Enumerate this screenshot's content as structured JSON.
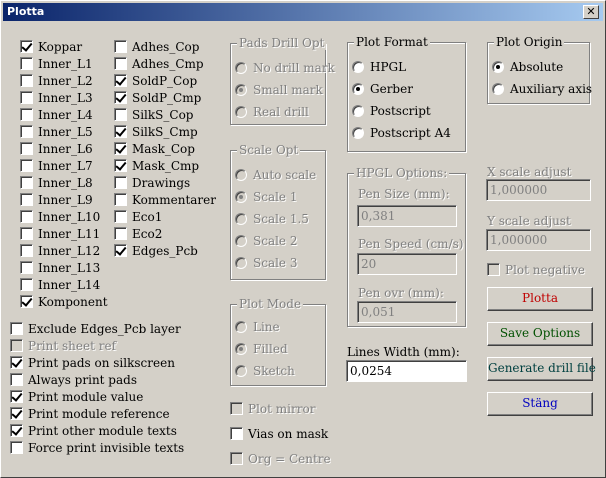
{
  "window": {
    "title": "Plotta",
    "close_label": "✕"
  },
  "layers_col1": [
    {
      "label": "Koppar",
      "checked": true
    },
    {
      "label": "Inner_L1",
      "checked": false
    },
    {
      "label": "Inner_L2",
      "checked": false
    },
    {
      "label": "Inner_L3",
      "checked": false
    },
    {
      "label": "Inner_L4",
      "checked": false
    },
    {
      "label": "Inner_L5",
      "checked": false
    },
    {
      "label": "Inner_L6",
      "checked": false
    },
    {
      "label": "Inner_L7",
      "checked": false
    },
    {
      "label": "Inner_L8",
      "checked": false
    },
    {
      "label": "Inner_L9",
      "checked": false
    },
    {
      "label": "Inner_L10",
      "checked": false
    },
    {
      "label": "Inner_L11",
      "checked": false
    },
    {
      "label": "Inner_L12",
      "checked": false
    },
    {
      "label": "Inner_L13",
      "checked": false
    },
    {
      "label": "Inner_L14",
      "checked": false
    },
    {
      "label": "Komponent",
      "checked": true
    }
  ],
  "layers_col2": [
    {
      "label": "Adhes_Cop",
      "checked": false
    },
    {
      "label": "Adhes_Cmp",
      "checked": false
    },
    {
      "label": "SoldP_Cop",
      "checked": true
    },
    {
      "label": "SoldP_Cmp",
      "checked": true
    },
    {
      "label": "SilkS_Cop",
      "checked": false
    },
    {
      "label": "SilkS_Cmp",
      "checked": true
    },
    {
      "label": "Mask_Cop",
      "checked": true
    },
    {
      "label": "Mask_Cmp",
      "checked": true
    },
    {
      "label": "Drawings",
      "checked": false
    },
    {
      "label": "Kommentarer",
      "checked": false
    },
    {
      "label": "Eco1",
      "checked": false
    },
    {
      "label": "Eco2",
      "checked": false
    },
    {
      "label": "Edges_Pcb",
      "checked": true
    }
  ],
  "options": [
    {
      "label": "Exclude Edges_Pcb layer",
      "checked": false,
      "disabled": false
    },
    {
      "label": "Print sheet ref",
      "checked": false,
      "disabled": true
    },
    {
      "label": "Print pads on silkscreen",
      "checked": true,
      "disabled": false
    },
    {
      "label": "Always print pads",
      "checked": false,
      "disabled": false
    },
    {
      "label": "Print module value",
      "checked": true,
      "disabled": false
    },
    {
      "label": "Print module reference",
      "checked": true,
      "disabled": false
    },
    {
      "label": "Print other module texts",
      "checked": true,
      "disabled": false
    },
    {
      "label": "Force print invisible texts",
      "checked": false,
      "disabled": false
    }
  ],
  "pads_drill": {
    "title": "Pads Drill Opt",
    "items": [
      {
        "label": "No drill mark",
        "on": false
      },
      {
        "label": "Small mark",
        "on": true
      },
      {
        "label": "Real drill",
        "on": false
      }
    ]
  },
  "scale_opt": {
    "title": "Scale Opt",
    "items": [
      {
        "label": "Auto scale",
        "on": false
      },
      {
        "label": "Scale 1",
        "on": true
      },
      {
        "label": "Scale 1.5",
        "on": false
      },
      {
        "label": "Scale 2",
        "on": false
      },
      {
        "label": "Scale 3",
        "on": false
      }
    ]
  },
  "plot_mode": {
    "title": "Plot Mode",
    "items": [
      {
        "label": "Line",
        "on": false
      },
      {
        "label": "Filled",
        "on": true
      },
      {
        "label": "Sketch",
        "on": false
      }
    ]
  },
  "mid_checks": {
    "plot_mirror": "Plot mirror",
    "vias_on_mask": "Vias on mask",
    "org_centre": "Org = Centre"
  },
  "plot_format": {
    "title": "Plot Format",
    "items": [
      {
        "label": "HPGL",
        "on": false
      },
      {
        "label": "Gerber",
        "on": true
      },
      {
        "label": "Postscript",
        "on": false
      },
      {
        "label": "Postscript A4",
        "on": false
      }
    ]
  },
  "hpgl": {
    "title": "HPGL Options:",
    "pen_size_label": "Pen Size (mm):",
    "pen_size": "0,381",
    "pen_speed_label": "Pen Speed (cm/s)",
    "pen_speed": "20",
    "pen_ovr_label": "Pen ovr (mm):",
    "pen_ovr": "0,051"
  },
  "lines_width": {
    "label": "Lines Width (mm):",
    "value": "0,0254"
  },
  "plot_origin": {
    "title": "Plot Origin",
    "items": [
      {
        "label": "Absolute",
        "on": true
      },
      {
        "label": "Auxiliary axis",
        "on": false
      }
    ]
  },
  "scale_adjust": {
    "x_label": "X scale adjust",
    "x_value": "1,000000",
    "y_label": "Y scale adjust",
    "y_value": "1,000000",
    "plot_negative": "Plot negative"
  },
  "buttons": {
    "plotta": {
      "label": "Plotta",
      "color": "#c00000"
    },
    "save": {
      "label": "Save Options",
      "color": "#005000"
    },
    "drill": {
      "label": "Generate drill file",
      "color": "#004040"
    },
    "close": {
      "label": "Stäng",
      "color": "#0000c0"
    }
  }
}
